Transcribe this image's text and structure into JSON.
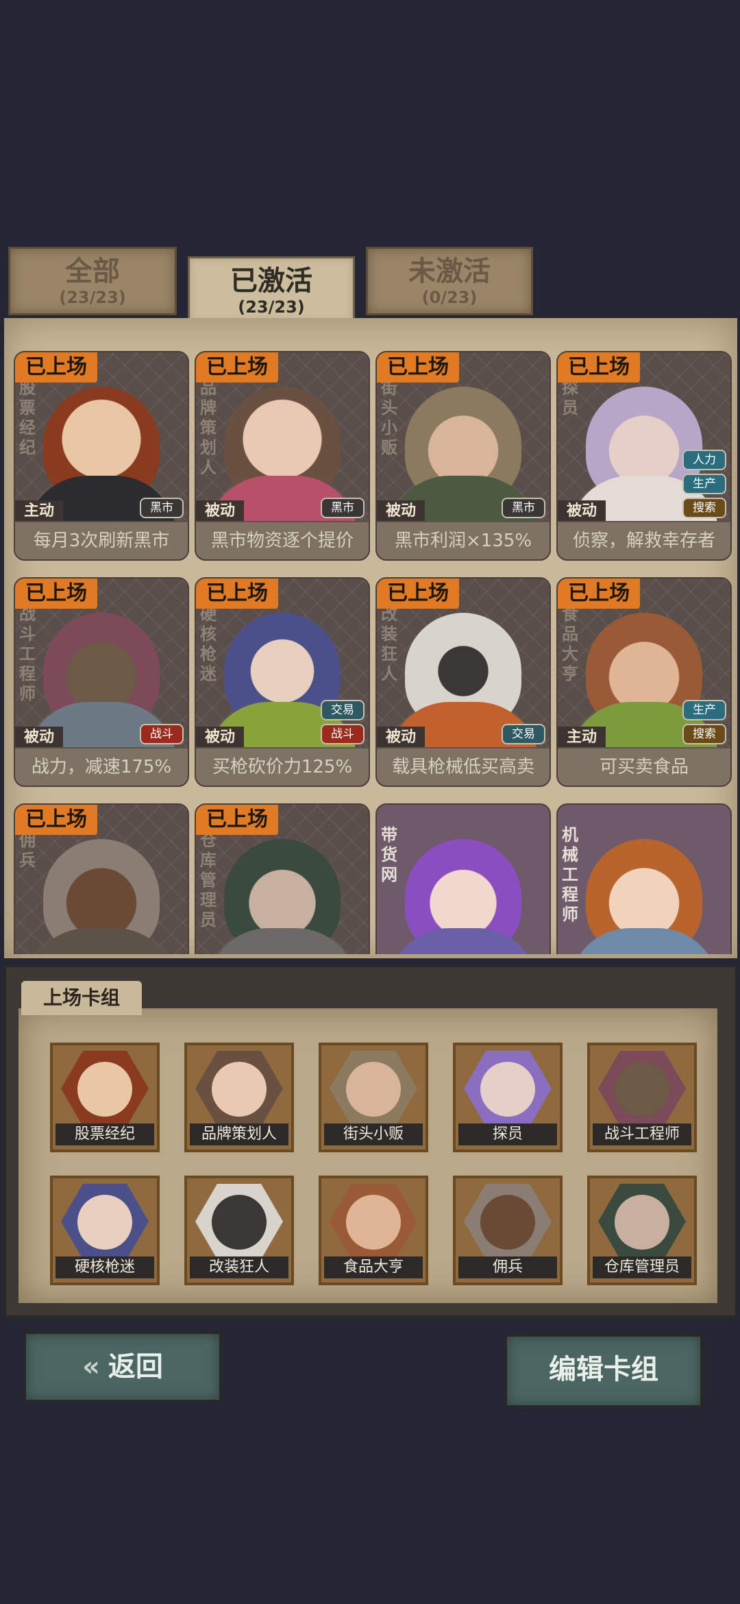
{
  "tabs": [
    {
      "label": "全部",
      "count": "(23/23)"
    },
    {
      "label": "已激活",
      "count": "(23/23)"
    },
    {
      "label": "未激活",
      "count": "(0/23)"
    }
  ],
  "cards": [
    {
      "status": "已上场",
      "name": "股票经纪",
      "type": "主动",
      "tags": [
        "黑市"
      ],
      "desc": "每月3次刷新黑市"
    },
    {
      "status": "已上场",
      "name": "品牌策划人",
      "type": "被动",
      "tags": [
        "黑市"
      ],
      "desc": "黑市物资逐个提价"
    },
    {
      "status": "已上场",
      "name": "街头小贩",
      "type": "被动",
      "tags": [
        "黑市"
      ],
      "desc": "黑市利润×135%"
    },
    {
      "status": "已上场",
      "name": "探员",
      "type": "被动",
      "tags": [
        "人力",
        "生产",
        "搜索"
      ],
      "desc": "侦察，解救幸存者"
    },
    {
      "status": "已上场",
      "name": "战斗工程师",
      "type": "被动",
      "tags": [
        "战斗"
      ],
      "desc": "战力，减速175%"
    },
    {
      "status": "已上场",
      "name": "硬核枪迷",
      "type": "被动",
      "tags": [
        "交易",
        "战斗"
      ],
      "desc": "买枪砍价力125%"
    },
    {
      "status": "已上场",
      "name": "改装狂人",
      "type": "被动",
      "tags": [
        "交易"
      ],
      "desc": "载具枪械低买高卖"
    },
    {
      "status": "已上场",
      "name": "食品大亨",
      "type": "主动",
      "tags": [
        "生产",
        "搜索"
      ],
      "desc": "可买卖食品"
    },
    {
      "status": "已上场",
      "name": "佣兵",
      "type": "",
      "tags": [],
      "desc": ""
    },
    {
      "status": "已上场",
      "name": "仓库管理员",
      "type": "",
      "tags": [],
      "desc": ""
    },
    {
      "status": "",
      "name": "带货网",
      "type": "",
      "tags": [],
      "desc": ""
    },
    {
      "status": "",
      "name": "机械工程师",
      "type": "",
      "tags": [],
      "desc": ""
    }
  ],
  "deck": {
    "title": "上场卡组",
    "members": [
      "股票经纪",
      "品牌策划人",
      "街头小贩",
      "探员",
      "战斗工程师",
      "硬核枪迷",
      "改装狂人",
      "食品大亨",
      "佣兵",
      "仓库管理员"
    ]
  },
  "buttons": {
    "back": "返回",
    "edit": "编辑卡组"
  },
  "colors": {
    "status_badge": "#e07a24",
    "panel": "#c9b99a",
    "button": "#4b6562"
  }
}
